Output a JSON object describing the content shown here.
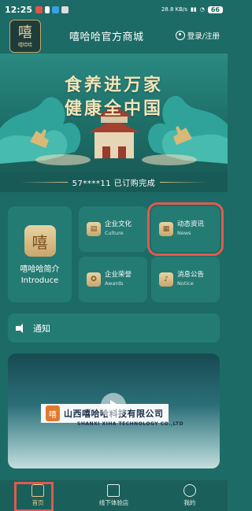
{
  "status_bar": {
    "time": "12:25",
    "network": "28.8 KB/s",
    "battery": "66"
  },
  "header": {
    "logo_glyph": "嘻",
    "logo_text": "嘻哈哈",
    "title": "嘻哈哈官方商城",
    "login": "登录/注册"
  },
  "banner": {
    "line1": "食养进万家",
    "line2": "健康全中国"
  },
  "ticker": {
    "text": "57****11 已订购完成"
  },
  "grid": {
    "intro": {
      "label_cn": "嘻哈哈简介",
      "label_en": "Introduce"
    },
    "culture": {
      "cn": "企业文化",
      "en": "Culture"
    },
    "news": {
      "cn": "动态资讯",
      "en": "News"
    },
    "awards": {
      "cn": "企业荣誉",
      "en": "Awards"
    },
    "notice": {
      "cn": "消息公告",
      "en": "Notice"
    }
  },
  "notice_bar": {
    "label": "通知"
  },
  "video": {
    "company_cn": "山西嘻哈哈科技有限公司",
    "company_en": "SHANXI XIHA TECHNOLOGY CO.,LTD"
  },
  "tabs": [
    {
      "label": "首页"
    },
    {
      "label": "线下体验店"
    },
    {
      "label": "我的"
    }
  ]
}
